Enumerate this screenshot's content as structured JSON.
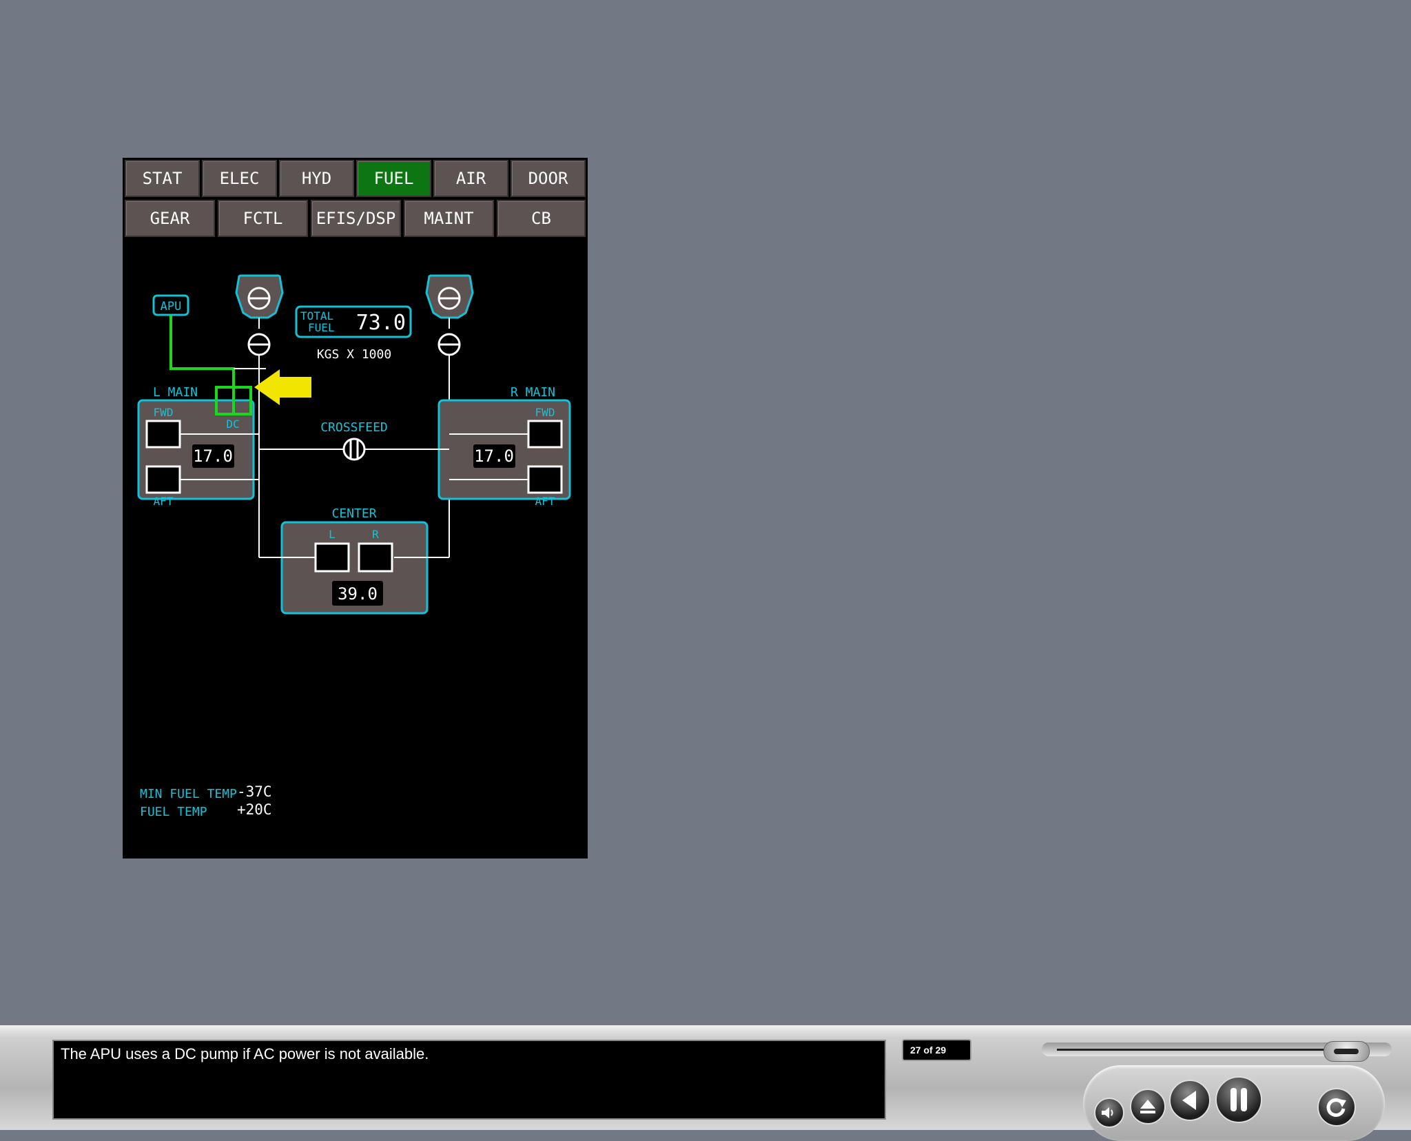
{
  "tabs_row1": [
    "STAT",
    "ELEC",
    "HYD",
    "FUEL",
    "AIR",
    "DOOR"
  ],
  "tabs_row2": [
    "GEAR",
    "FCTL",
    "EFIS/DSP",
    "MAINT",
    "CB"
  ],
  "active_tab": "FUEL",
  "synoptic": {
    "apu_label": "APU",
    "total_fuel_label_line1": "TOTAL",
    "total_fuel_label_line2": "FUEL",
    "total_fuel_value": "73.0",
    "units": "KGS X 1000",
    "l_main_label": "L MAIN",
    "r_main_label": "R MAIN",
    "fwd_label": "FWD",
    "aft_label": "AFT",
    "dc_label": "DC",
    "crossfeed_label": "CROSSFEED",
    "center_label": "CENTER",
    "center_l": "L",
    "center_r": "R",
    "l_main_qty": "17.0",
    "r_main_qty": "17.0",
    "center_qty": "39.0",
    "min_fuel_temp_label": "MIN FUEL TEMP",
    "min_fuel_temp_value": "-37C",
    "fuel_temp_label": "FUEL TEMP",
    "fuel_temp_value": "+20C"
  },
  "caption": "The APU uses a DC pump if AC power is not available.",
  "counter": "27 of 29",
  "progress": 0.93,
  "colors": {
    "cyan": "#12c3d8",
    "green": "#19d81e",
    "active_tab": "#0d7512",
    "arrow": "#f2e600"
  },
  "controls": [
    "volume-icon",
    "eject-icon",
    "previous-icon",
    "pause-icon",
    "replay-icon"
  ]
}
